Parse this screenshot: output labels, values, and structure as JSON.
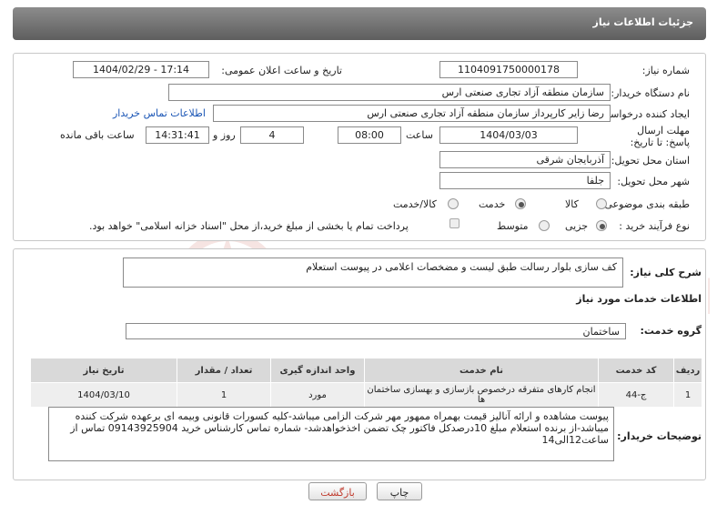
{
  "header": {
    "title": "جزئیات اطلاعات نیاز"
  },
  "form": {
    "need_number": {
      "label": "شماره نیاز:",
      "value": "1104091750000178"
    },
    "announce": {
      "label": "تاریخ و ساعت اعلان عمومی:",
      "value": "1404/02/29 - 17:14"
    },
    "buyer_org": {
      "label": "نام دستگاه خریدار:",
      "value": "سازمان منطقه آزاد تجاری صنعتی ارس"
    },
    "creator": {
      "label": "ایجاد کننده درخواست:",
      "value": "رضا زایر کارپرداز سازمان منطقه آزاد تجاری صنعتی ارس",
      "contact_link": "اطلاعات تماس خریدار"
    },
    "deadline": {
      "label": "مهلت ارسال پاسخ: تا تاریخ:",
      "date": "1404/03/03",
      "time_label": "ساعت",
      "time": "08:00",
      "days": "4",
      "days_label": "روز و",
      "remaining": "14:31:41",
      "remaining_label": "ساعت باقی مانده"
    },
    "province": {
      "label": "استان محل تحویل:",
      "value": "آذربایجان شرقی"
    },
    "city": {
      "label": "شهر محل تحویل:",
      "value": "جلفا"
    },
    "category": {
      "label": "طبقه بندی موضوعی:",
      "options": [
        "کالا",
        "خدمت",
        "کالا/خدمت"
      ],
      "selected": "خدمت"
    },
    "process": {
      "label": "نوع فرآیند خرید :",
      "options": [
        "جزیی",
        "متوسط"
      ],
      "selected": "جزیی",
      "payment_note": "پرداخت تمام یا بخشی از مبلغ خرید،از محل \"اسناد خزانه اسلامی\" خواهد بود."
    }
  },
  "summary": {
    "label": "شرح کلی نیاز:",
    "value": "کف سازی بلوار رسالت طبق لیست و مضخصات اعلامی در پیوست استعلام"
  },
  "services": {
    "section_title": "اطلاعات خدمات مورد نیاز",
    "group_label": "گروه خدمت:",
    "group_value": "ساختمان",
    "columns": [
      "ردیف",
      "کد خدمت",
      "نام خدمت",
      "واحد اندازه گیری",
      "تعداد / مقدار",
      "تاریخ نیاز"
    ],
    "rows": [
      [
        "1",
        "ج-44",
        "انجام کارهای متفرقه درخصوص بازسازی و بهسازی ساختمان ها",
        "مورد",
        "1",
        "1404/03/10"
      ]
    ]
  },
  "buyer_notes": {
    "label": "توضیحات خریدار:",
    "value": "پیوست مشاهده و ارائه آنالیز قیمت بهمراه ممهور مهر شرکت الزامی میباشد-کلیه کسورات قانونی وبیمه ای برعهده شرکت کننده میباشد-از برنده استعلام مبلغ 10درصدکل فاکتور چک تضمن اخذخواهدشد- شماره تماس کارشناس خرید 09143925904 تماس از ساعت12الی14"
  },
  "buttons": {
    "print": "چاپ",
    "back": "بازگشت"
  },
  "watermark": {
    "text": "AriaTender.net"
  },
  "colors": {
    "header_bg": "#6f6f6f",
    "link": "#1a55b5",
    "back_button": "#c0392b"
  }
}
